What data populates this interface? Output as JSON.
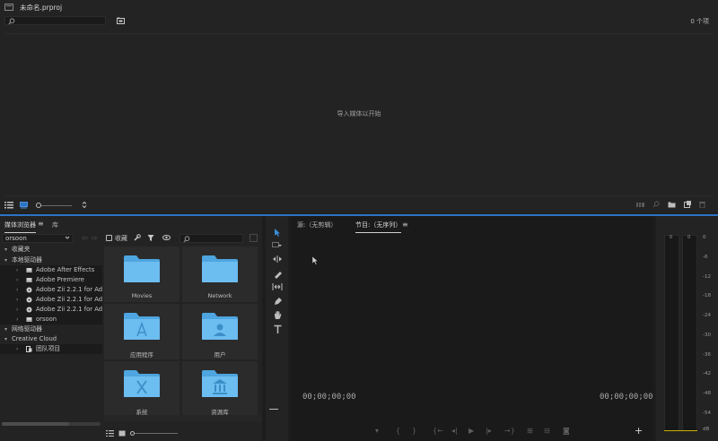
{
  "project": {
    "title": "未命名.prproj",
    "item_count": "0 个项",
    "import_hint": "导入媒体以开始",
    "search_placeholder": ""
  },
  "media_browser": {
    "tabs": [
      "媒体浏览器",
      "库"
    ],
    "tabs_menu": "≡",
    "drive_select": "orsoon",
    "favorites_label": "收藏",
    "tree": [
      {
        "label": "收藏夹",
        "level": 0,
        "expanded": true
      },
      {
        "label": "本地驱动器",
        "level": 0,
        "expanded": true
      },
      {
        "label": "Adobe After Effects",
        "level": 1,
        "icon": "drive-icon"
      },
      {
        "label": "Adobe Premiere",
        "level": 1,
        "icon": "drive-icon"
      },
      {
        "label": "Adobe Zii 2.2.1  for Ado",
        "level": 1,
        "icon": "disk-icon"
      },
      {
        "label": "Adobe Zii 2.2.1  for Ado",
        "level": 1,
        "icon": "disk-icon"
      },
      {
        "label": "Adobe Zii 2.2.1  for Ado",
        "level": 1,
        "icon": "disk-icon"
      },
      {
        "label": "orsoon",
        "level": 1,
        "icon": "drive-icon"
      },
      {
        "label": "网络驱动器",
        "level": 0,
        "expanded": true
      },
      {
        "label": "Creative Cloud",
        "level": 0,
        "expanded": true
      },
      {
        "label": "团队项目",
        "level": 1,
        "icon": "team-icon"
      }
    ],
    "folders": [
      {
        "name": "Movies",
        "glyph": "movies"
      },
      {
        "name": "Network",
        "glyph": "plain"
      },
      {
        "name": "应用程序",
        "glyph": "apps"
      },
      {
        "name": "用户",
        "glyph": "users"
      },
      {
        "name": "系统",
        "glyph": "system"
      },
      {
        "name": "资源库",
        "glyph": "library"
      }
    ]
  },
  "monitor": {
    "source_tab": "源:（无剪辑）",
    "program_tab": "节目:（无序列）",
    "program_menu": "≡",
    "timecode_left": "00;00;00;00",
    "timecode_right": "00;00;00;00",
    "add_label": "+"
  },
  "meters": {
    "scale": [
      "0",
      "-6",
      "-12",
      "-18",
      "-24",
      "-30",
      "-36",
      "-42",
      "-48",
      "-54",
      "dB"
    ],
    "top_labels": [
      "0",
      "0"
    ]
  },
  "colors": {
    "accent": "#2d74c4",
    "folder": "#5fb5ec",
    "meter_peak": "#c7b200"
  }
}
